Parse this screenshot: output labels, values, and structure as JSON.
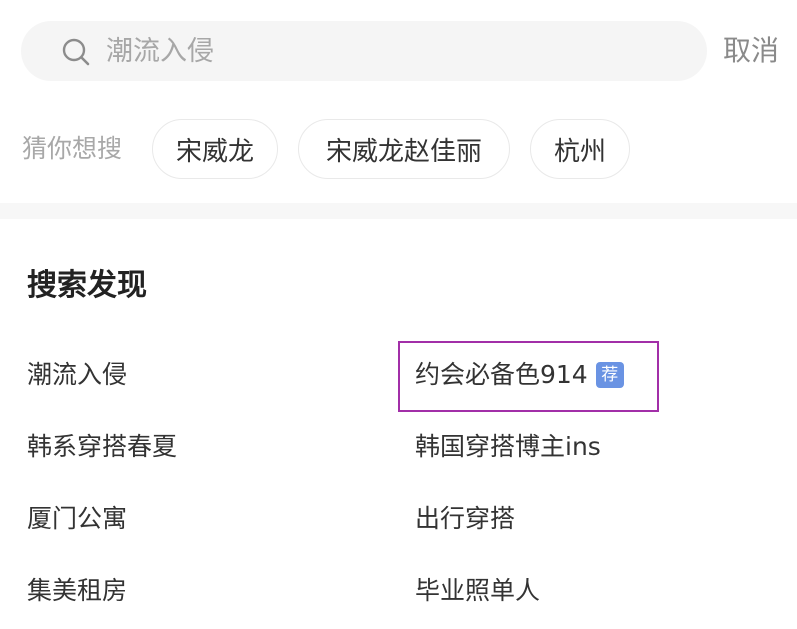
{
  "search": {
    "placeholder": "潮流入侵",
    "cancel_label": "取消"
  },
  "guess": {
    "label": "猜你想搜",
    "chips": [
      "宋威龙",
      "宋威龙赵佳丽",
      "杭州"
    ]
  },
  "discover": {
    "title": "搜索发现",
    "left_items": [
      "潮流入侵",
      "韩系穿搭春夏",
      "厦门公寓",
      "集美租房"
    ],
    "right_items": [
      {
        "label": "约会必备色914",
        "badge": "荐"
      },
      {
        "label": "韩国穿搭博主ins"
      },
      {
        "label": "出行穿搭"
      },
      {
        "label": "毕业照单人"
      }
    ]
  },
  "colors": {
    "badge": "#6a93e3",
    "highlight_border": "#a22fa8"
  }
}
